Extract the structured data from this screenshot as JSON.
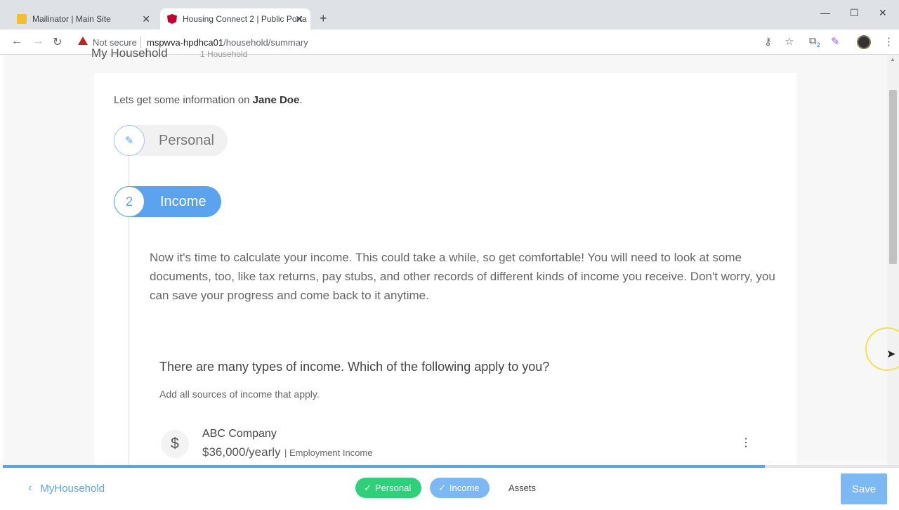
{
  "browser": {
    "tabs": [
      {
        "title": "Mailinator | Main Site",
        "icon": "mailinator-favicon"
      },
      {
        "title": "Housing Connect 2 | Public Porta",
        "icon": "angular-favicon"
      }
    ],
    "security_label": "Not secure",
    "url_host": "mspwva-hpdhca01",
    "url_path": "/household/summary",
    "extension_badge": "2"
  },
  "page": {
    "breadcrumb_title": "My Household",
    "breadcrumb_sub": "1 Household",
    "intro_prefix": "Lets get some information on ",
    "intro_name": "Jane Doe",
    "intro_suffix": ".",
    "steps": [
      {
        "label": "Personal",
        "icon": "pencil-icon"
      },
      {
        "number": "2",
        "label": "Income"
      }
    ],
    "income_intro": "Now it's time to calculate your income. This could take a while, so get comfortable! You will need to look at some documents, too, like tax returns, pay stubs, and other records of different kinds of income you receive. Don't worry, you can save your progress and come back to it anytime.",
    "question": "There are many types of income. Which of the following apply to you?",
    "hint": "Add all sources of income that apply.",
    "income_items": [
      {
        "name": "ABC Company",
        "amount": "$36,000/yearly",
        "type": "| Employment Income",
        "icon_glyph": "$"
      }
    ]
  },
  "footer": {
    "back_label": "MyHousehold",
    "progress_fraction": 0.85,
    "steps": [
      {
        "label": "Personal",
        "state": "complete",
        "color": "#2ed07a"
      },
      {
        "label": "Income",
        "state": "current",
        "color": "#7cb9f4"
      },
      {
        "label": "Assets",
        "state": "pending"
      }
    ],
    "save_label": "Save"
  },
  "colors": {
    "accent": "#5ba3ee",
    "success": "#2ed07a"
  }
}
